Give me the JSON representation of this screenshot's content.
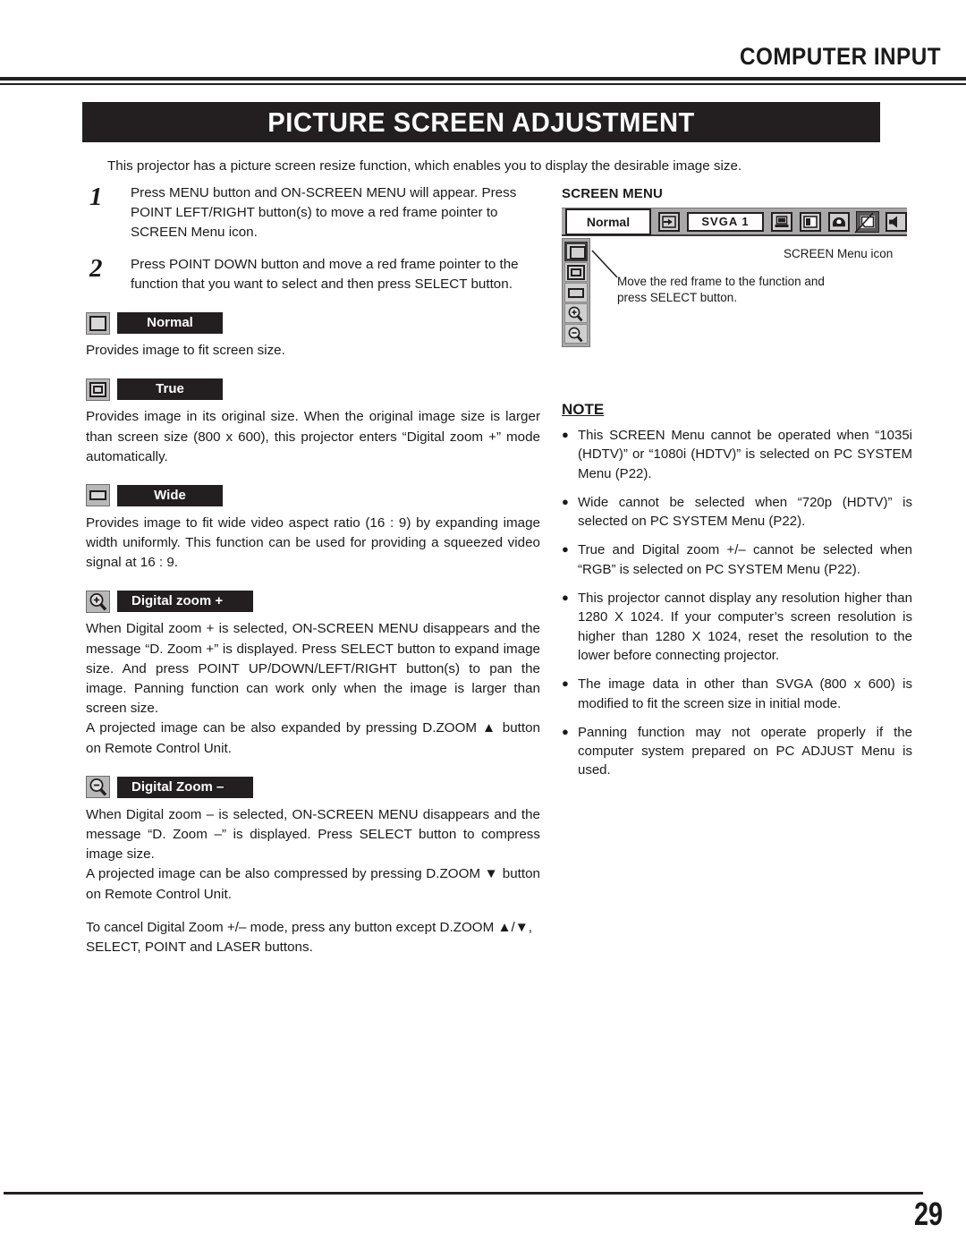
{
  "header": {
    "section_title": "COMPUTER INPUT"
  },
  "banner": {
    "title": "PICTURE SCREEN ADJUSTMENT"
  },
  "intro": "This projector has a picture screen resize function, which enables you to display the desirable image size.",
  "steps": [
    {
      "number": "1",
      "line1": "Press MENU button and ON-SCREEN MENU will appear.  Press",
      "line2": "POINT LEFT/RIGHT button(s) to move a red frame pointer to",
      "line3": "SCREEN Menu icon."
    },
    {
      "number": "2",
      "line1": "Press POINT DOWN button and move a red frame pointer to the",
      "line2": "function that you want to select and then press SELECT button."
    }
  ],
  "functions": [
    {
      "icon": "screen-normal-icon",
      "label": "Normal",
      "paragraphs": [
        "Provides image to fit screen size."
      ]
    },
    {
      "icon": "screen-true-icon",
      "label": "True",
      "paragraphs": [
        "Provides image in its original size.  When the original image size is larger than screen size (800 x 600), this projector enters “Digital zoom +” mode automatically."
      ]
    },
    {
      "icon": "screen-wide-icon",
      "label": "Wide",
      "paragraphs": [
        "Provides image to fit wide video aspect ratio (16 : 9) by expanding image width uniformly.  This function can be used for providing a squeezed video signal at 16 : 9."
      ]
    },
    {
      "icon": "zoom-in-icon",
      "label": "Digital zoom +",
      "paragraphs": [
        "When Digital zoom + is selected, ON-SCREEN MENU disappears and the message “D. Zoom +” is displayed.  Press SELECT button to expand image size.  And press POINT UP/DOWN/LEFT/RIGHT button(s) to pan the image.  Panning function can work only when the image is larger than screen size.",
        "A projected image can be also expanded by pressing D.ZOOM ▲ button on Remote Control Unit."
      ]
    },
    {
      "icon": "zoom-out-icon",
      "label": "Digital Zoom –",
      "paragraphs": [
        "When Digital zoom – is selected, ON-SCREEN MENU disappears and the message “D. Zoom –” is displayed.  Press SELECT button to compress image size.",
        "A projected image can be also compressed by pressing D.ZOOM ▼ button on Remote Control Unit."
      ]
    }
  ],
  "cancel_note": "To cancel Digital Zoom +/– mode, press any button except D.ZOOM ▲/▼, SELECT, POINT and LASER buttons.",
  "screen_menu": {
    "title": "SCREEN MENU",
    "selected_value": "Normal",
    "system_value": "SVGA 1",
    "callout_icon": "SCREEN Menu icon",
    "callout_move_line1": "Move the red frame to the function and",
    "callout_move_line2": "press SELECT button.",
    "bar_icons": [
      "input-source-icon",
      "pc-adjust-icon",
      "image-select-icon",
      "image-adjust-icon",
      "screen-icon",
      "sound-icon"
    ],
    "side_icons": [
      "screen-normal-icon",
      "screen-true-icon",
      "screen-wide-icon",
      "zoom-in-icon",
      "zoom-out-icon"
    ]
  },
  "note": {
    "title": "NOTE",
    "bullet": "●",
    "items": [
      "This SCREEN Menu cannot be operated when “1035i (HDTV)” or “1080i (HDTV)” is selected on PC SYSTEM Menu  (P22).",
      "Wide cannot be selected when “720p (HDTV)” is selected on PC SYSTEM Menu  (P22).",
      "True and Digital zoom +/– cannot be selected when “RGB” is selected on PC SYSTEM Menu (P22).",
      "This projector cannot display any resolution higher than 1280 X 1024.  If your computer’s screen resolution is higher than 1280 X 1024, reset the resolution to the lower before connecting projector.",
      "The image data in other than SVGA (800 x 600) is modified to fit the screen size in initial mode.",
      "Panning function may not operate properly if the computer system prepared on PC ADJUST Menu is used."
    ]
  },
  "footer": {
    "page_number": "29"
  }
}
